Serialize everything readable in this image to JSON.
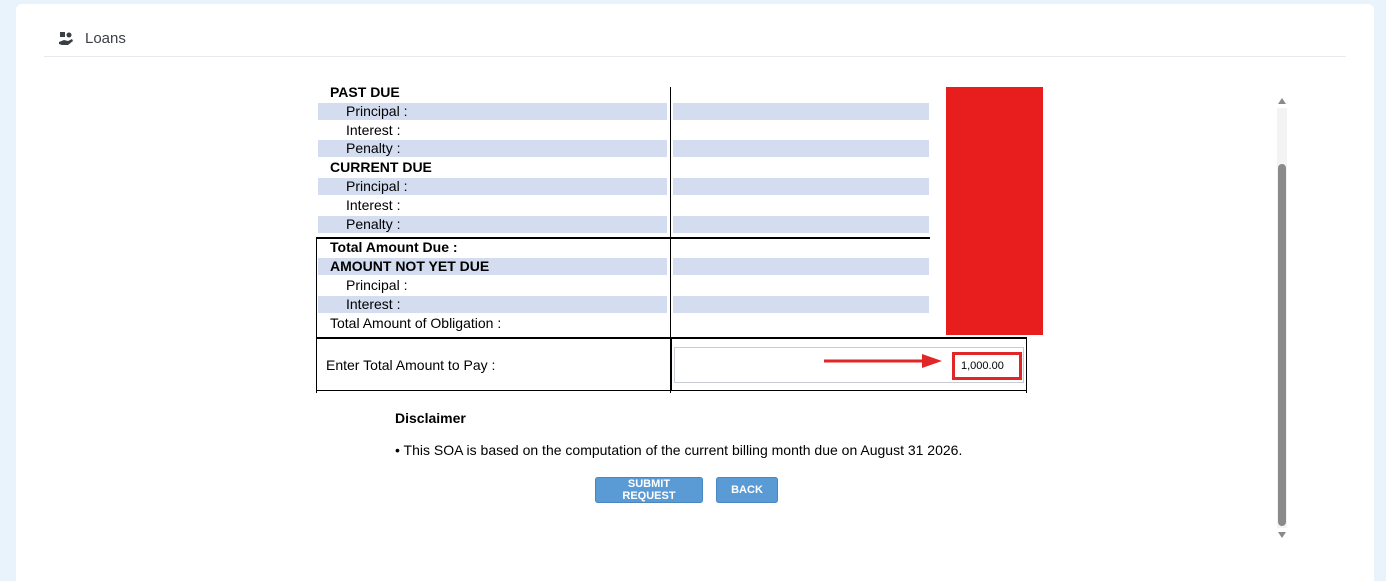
{
  "header": {
    "title": "Loans",
    "icon": "loan-hand-icon"
  },
  "soa": {
    "rows": [
      {
        "label": "PAST DUE",
        "style": "sec",
        "shade": false
      },
      {
        "label": "Principal :",
        "style": "indent",
        "shade": true
      },
      {
        "label": "Interest :",
        "style": "indent",
        "shade": false
      },
      {
        "label": "Penalty :",
        "style": "indent",
        "shade": true
      },
      {
        "label": "CURRENT DUE",
        "style": "sec",
        "shade": false
      },
      {
        "label": "Principal :",
        "style": "indent",
        "shade": true
      },
      {
        "label": "Interest :",
        "style": "indent",
        "shade": false
      },
      {
        "label": "Penalty :",
        "style": "indent",
        "shade": true
      },
      {
        "label": "Total Amount Due :",
        "style": "sec",
        "shade": false
      },
      {
        "label": "AMOUNT NOT YET DUE",
        "style": "sec",
        "shade": true
      },
      {
        "label": "Principal :",
        "style": "indent",
        "shade": false
      },
      {
        "label": "Interest :",
        "style": "indent",
        "shade": true
      },
      {
        "label": "Total Amount of Obligation :",
        "style": "plain",
        "shade": false
      }
    ],
    "pay_label": "Enter Total Amount to Pay :",
    "pay_value": "1,000.00"
  },
  "disclaimer": {
    "title": "Disclaimer",
    "note": "• This SOA is based on the computation of the current billing month due on August 31 2026."
  },
  "buttons": {
    "submit": "SUBMIT REQUEST",
    "back": "BACK"
  },
  "colors": {
    "redaction": "#e81d1d",
    "row_shade": "#d3ddef",
    "button": "#5b9bd5"
  }
}
